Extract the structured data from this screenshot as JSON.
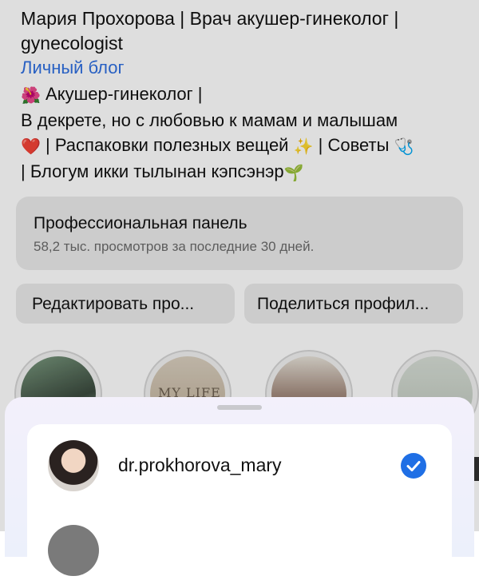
{
  "profile": {
    "name": "Мария Прохорова | Врач акушер-гинеколог | gynecologist",
    "blog_link": "Личный блог",
    "bio": {
      "line1_emoji": "🌺",
      "line1_text": "Акушер-гинеколог |",
      "line2_text": "В декрете, но с любовью к мамам и малышам",
      "line3_emoji_heart": "❤️",
      "line3_text": "| Распаковки полезных вещей",
      "line3_emoji_sparkles": "✨",
      "line3_text2": "| Советы",
      "line3_emoji_stethoscope": "🩺",
      "line4_text": "| Блогум икки тылынан кэпсэнэр",
      "line4_emoji": "🌱"
    }
  },
  "pro_panel": {
    "title": "Профессиональная панель",
    "subtitle": "58,2 тыс. просмотров за последние 30 дней."
  },
  "actions": {
    "edit_label": "Редактировать про...",
    "share_label": "Поделиться профил..."
  },
  "highlights": {
    "second_text": "MY LIFE"
  },
  "account_switcher": {
    "accounts": [
      {
        "username": "dr.prokhorova_mary",
        "selected": true
      }
    ],
    "accent_color": "#1f6fe5"
  }
}
